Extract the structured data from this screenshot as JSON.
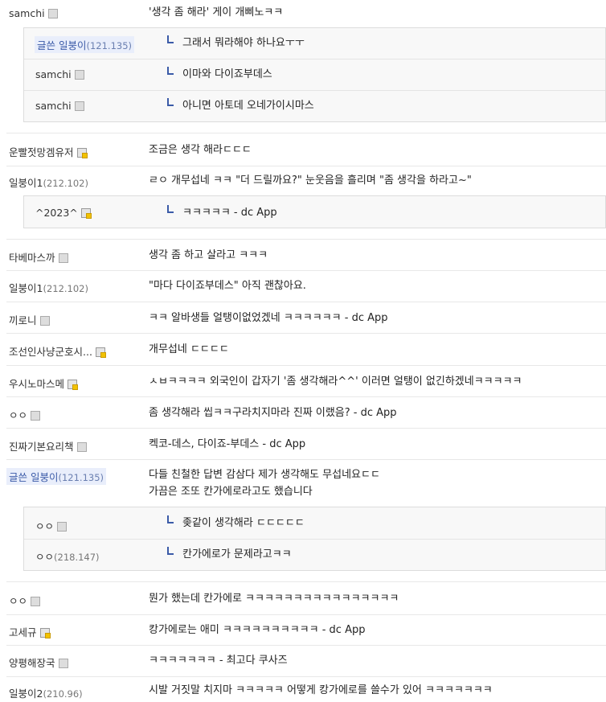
{
  "comments": [
    {
      "nick": "samchi",
      "content": "'생각 좀 해라' 게이 개삐노ㅋㅋ"
    },
    {
      "nick": "운빨젓망겜유저",
      "content": "조금은 생각 해라ㄷㄷㄷ"
    },
    {
      "nick": "일붕이1",
      "ip": "(212.102)",
      "content": "ㄹㅇ 개무섭네 ㅋㅋ \"더 드릴까요?\" 눈웃음을 흘리며 \"좀 생각을 하라고~\""
    },
    {
      "nick": "타베마스까",
      "content": "생각 좀 하고 살라고 ㅋㅋㅋ"
    },
    {
      "nick": "일붕이1",
      "ip": "(212.102)",
      "content": "\"마다 다이죠부데스\" 아직 괜찮아요."
    },
    {
      "nick": "끼로니",
      "content": "ㅋㅋ 알바생들 얼탱이없었겠네 ㅋㅋㅋㅋㅋㅋ - dc App"
    },
    {
      "nick": "조선인사냥군호시...",
      "content": "개무섭네 ㄷㄷㄷㄷ"
    },
    {
      "nick": "우시노마스메",
      "content": "ㅅㅂㅋㅋㅋㅋ 외국인이 갑자기 '좀 생각해라^^' 이러면 얼탱이 없긴하겠네ㅋㅋㅋㅋㅋ"
    },
    {
      "nick": "ㅇㅇ",
      "content": "좀 생각해라 씹ㅋㅋ구라치지마라 진짜 이랬음? - dc App"
    },
    {
      "nick": "진짜기본요리책",
      "content": "켁코-데스, 다이죠-부데스 - dc App"
    },
    {
      "nick": "글쓴 일붕이",
      "ip": "(121.135)",
      "content": "다들 친철한 답변 감삼다 제가 생각해도 무섭네요ㄷㄷ",
      "content2": "가끔은 조또 칸가에로라고도 했습니다"
    },
    {
      "nick": "ㅇㅇ",
      "content": "뭔가 했는데 칸가에로 ㅋㅋㅋㅋㅋㅋㅋㅋㅋㅋㅋㅋㅋㅋㅋㅋ"
    },
    {
      "nick": "고세규",
      "content": "캉가에로는 애미 ㅋㅋㅋㅋㅋㅋㅋㅋㅋㅋ - dc App"
    },
    {
      "nick": "양평해장국",
      "content": "ㅋㅋㅋㅋㅋㅋㅋ - 최고다 쿠사즈"
    },
    {
      "nick": "일붕이2",
      "ip": "(210.96)",
      "content": "시발 거짓말 치지마 ㅋㅋㅋㅋㅋ 어떻게 캉가에로를 쓸수가 있어 ㅋㅋㅋㅋㅋㅋㅋ"
    }
  ],
  "replies": [
    {
      "nick": "글쓴 일붕이",
      "ip": "(121.135)",
      "content": "그래서 뭐라해야 하나요ㅜㅜ"
    },
    {
      "nick": "samchi",
      "content": "이마와 다이죠부데스"
    },
    {
      "nick": "samchi",
      "content": "아니면 아토데 오네가이시마스"
    },
    {
      "nick": "^2023^",
      "content": "ㅋㅋㅋㅋㅋ - dc App"
    },
    {
      "nick": "ㅇㅇ",
      "content": "좆같이 생각해라 ㄷㄷㄷㄷㄷ"
    },
    {
      "nick": "ㅇㅇ",
      "ip": "(218.147)",
      "content": "칸가에로가 문제라고ㅋㅋ"
    }
  ]
}
